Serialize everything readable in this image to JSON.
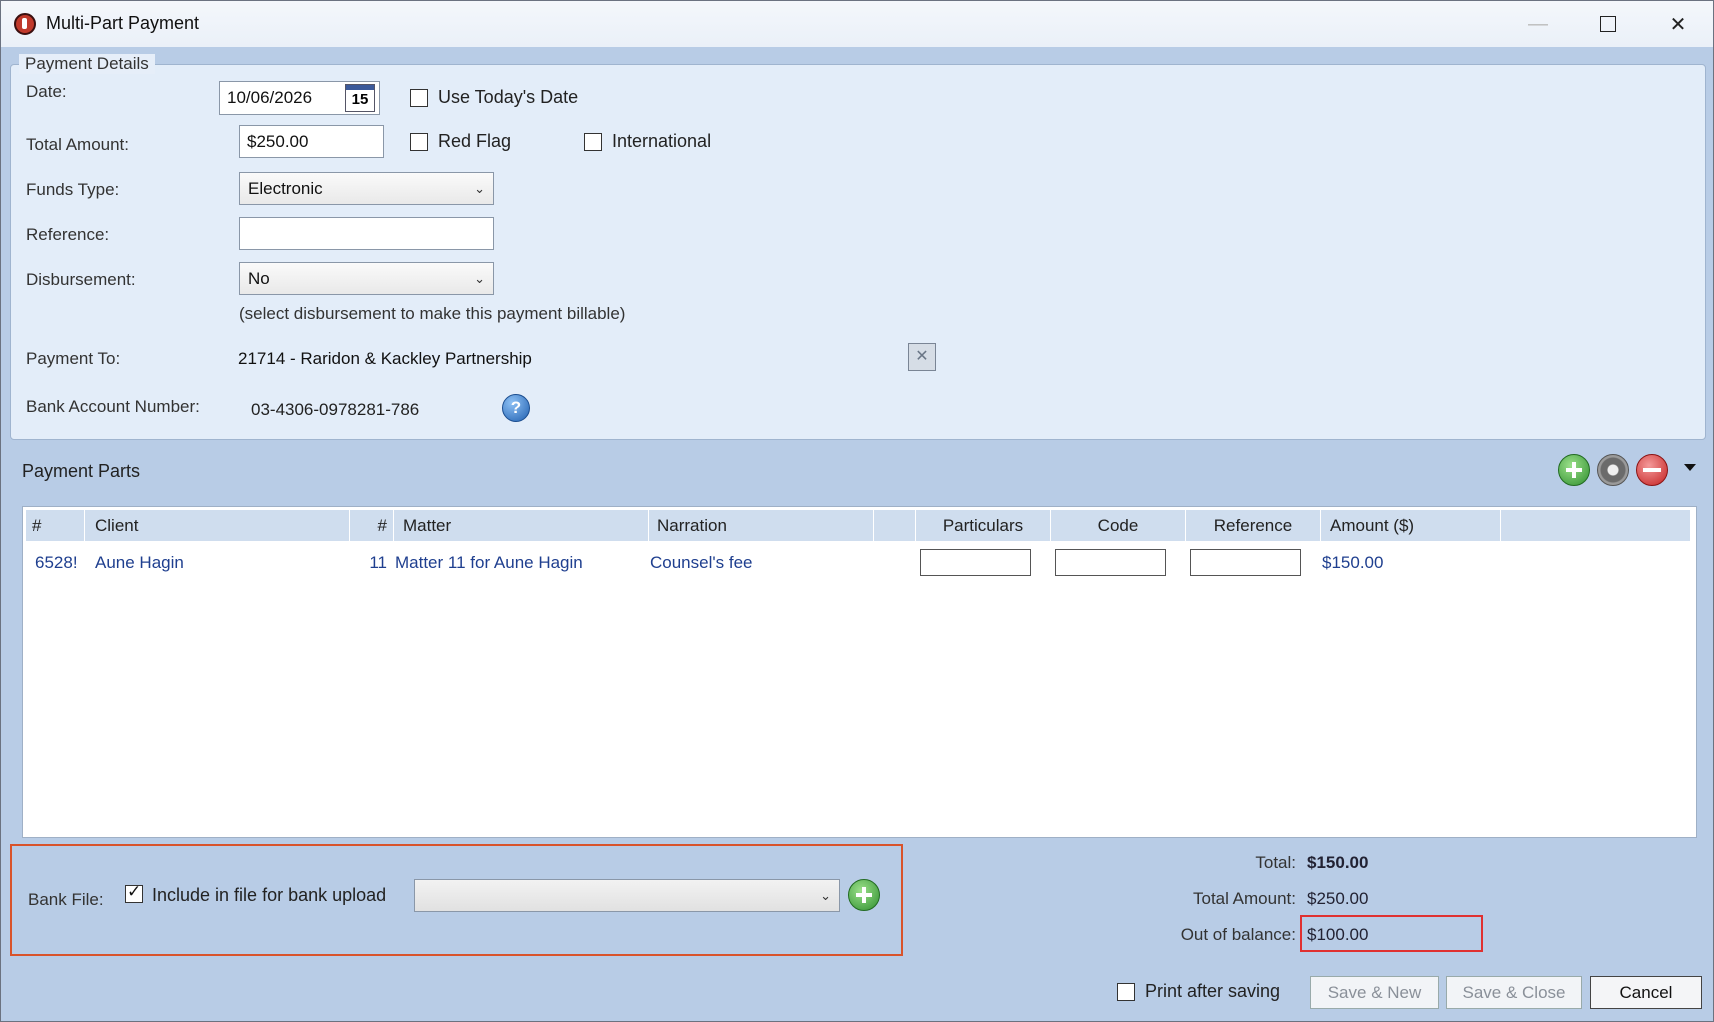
{
  "window": {
    "title": "Multi-Part Payment"
  },
  "details": {
    "legend": "Payment Details",
    "date_label": "Date:",
    "date_value": "10/06/2026",
    "cal_day": "15",
    "use_today_label": "Use Today's Date",
    "total_amount_label": "Total Amount:",
    "total_amount_value": "$250.00",
    "red_flag_label": "Red Flag",
    "international_label": "International",
    "funds_type_label": "Funds Type:",
    "funds_type_value": "Electronic",
    "reference_label": "Reference:",
    "reference_value": "",
    "disbursement_label": "Disbursement:",
    "disbursement_value": "No",
    "disbursement_hint": "(select disbursement to make this payment billable)",
    "payment_to_label": "Payment To:",
    "payment_to_value": "21714 - Raridon & Kackley Partnership",
    "clear_glyph": "✕",
    "bank_account_label": "Bank Account Number:",
    "bank_account_value": "03-4306-0978281-786",
    "help_glyph": "?"
  },
  "parts": {
    "title": "Payment Parts",
    "columns": [
      "#",
      "Client",
      "#",
      "Matter",
      "Narration",
      "",
      "Particulars",
      "Code",
      "Reference",
      "Amount ($)"
    ],
    "rows": [
      {
        "num": "6528!",
        "client": "Aune Hagin",
        "matter_num": "11",
        "matter": "Matter 11 for Aune Hagin",
        "narration": "Counsel's fee",
        "particulars": "",
        "code": "",
        "reference": "",
        "amount": "$150.00"
      }
    ]
  },
  "bank_file": {
    "label": "Bank File:",
    "include_label": "Include in file for bank upload",
    "include_checked": true,
    "selected": ""
  },
  "totals": {
    "total_label": "Total:",
    "total_value": "$150.00",
    "total_amount_label": "Total Amount:",
    "total_amount_value": "$250.00",
    "oob_label": "Out of balance:",
    "oob_value": "$100.00"
  },
  "footer": {
    "print_label": "Print after saving",
    "save_new": "Save & New",
    "save_close": "Save & Close",
    "cancel": "Cancel"
  },
  "icons": [
    "app-icon",
    "calendar-icon",
    "help-icon",
    "add-icon",
    "gear-icon",
    "remove-icon",
    "chevron-down-icon",
    "close-icon",
    "maximize-icon",
    "minimize-icon"
  ],
  "colors": {
    "accent_border": "#d9532b",
    "oob_border": "#e03030",
    "link_text": "#1f3f8f"
  }
}
